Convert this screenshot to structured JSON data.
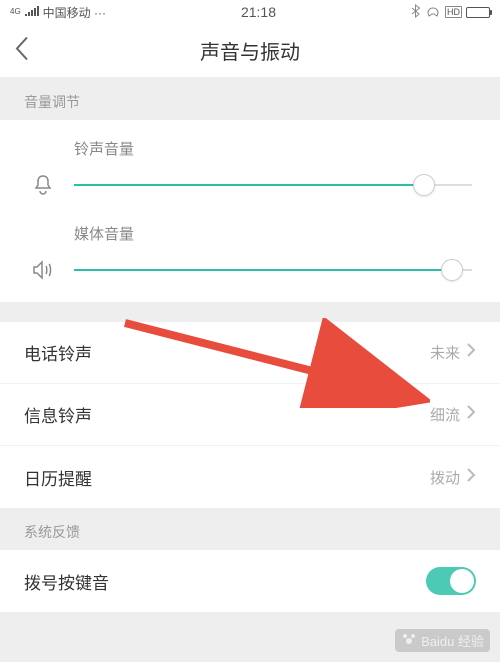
{
  "status": {
    "signal_label": "4G",
    "carrier": "中国移动 ···",
    "time": "21:18",
    "hd_label": "HD"
  },
  "header": {
    "title": "声音与振动"
  },
  "sections": {
    "volume_label": "音量调节",
    "feedback_label": "系统反馈"
  },
  "volume": {
    "ringtone": {
      "label": "铃声音量",
      "percent": 88
    },
    "media": {
      "label": "媒体音量",
      "percent": 95
    }
  },
  "ringtone_list": [
    {
      "label": "电话铃声",
      "value": "未来"
    },
    {
      "label": "信息铃声",
      "value": "细流"
    },
    {
      "label": "日历提醒",
      "value": "拨动"
    }
  ],
  "feedback": {
    "dial_tone_label": "拨号按键音",
    "dial_tone_on": true
  },
  "watermark": "Baidu 经验"
}
